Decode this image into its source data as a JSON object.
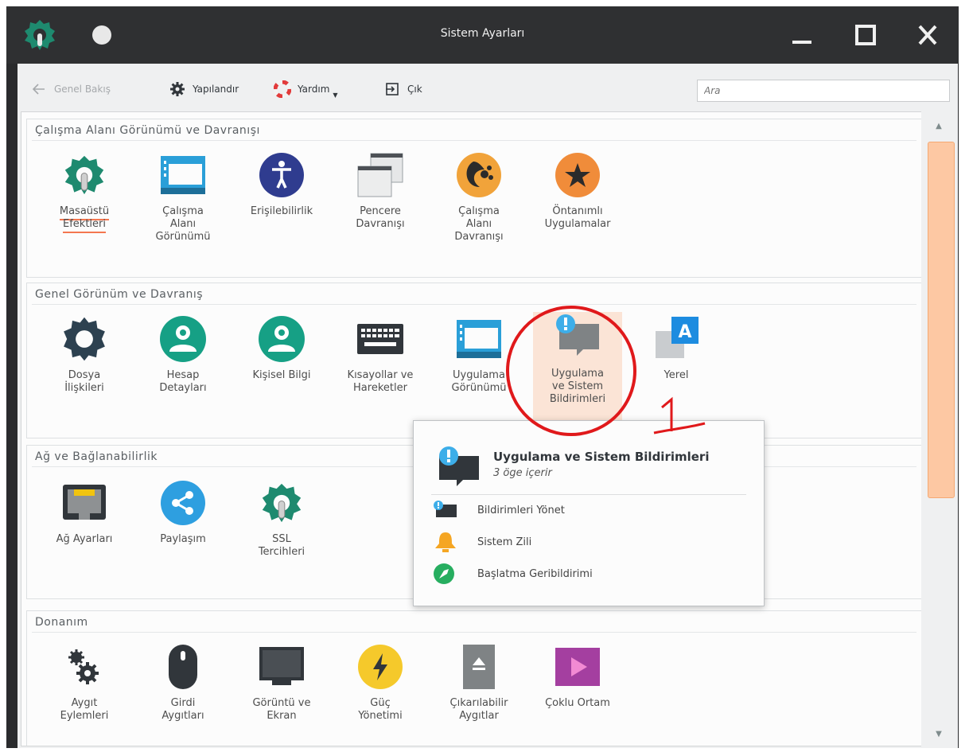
{
  "window": {
    "title": "Sistem Ayarları"
  },
  "toolbar": {
    "back_label": "Genel Bakış",
    "configure_label": "Yapılandır",
    "help_label": "Yardım",
    "quit_label": "Çık",
    "search_placeholder": "Ara"
  },
  "sections": [
    {
      "title": "Çalışma Alanı Görünümü ve Davranışı",
      "items": [
        {
          "label": "Masaüstü\nEfektleri",
          "icon": "desktop-effects-icon"
        },
        {
          "label": "Çalışma\nAlanı\nGörünümü",
          "icon": "workspace-appearance-icon"
        },
        {
          "label": "Erişilebilirlik",
          "icon": "accessibility-icon"
        },
        {
          "label": "Pencere\nDavranışı",
          "icon": "window-behavior-icon"
        },
        {
          "label": "Çalışma\nAlanı\nDavranışı",
          "icon": "workspace-behavior-icon"
        },
        {
          "label": "Öntanımlı\nUygulamalar",
          "icon": "default-apps-icon"
        }
      ]
    },
    {
      "title": "Genel Görünüm ve Davranış",
      "items": [
        {
          "label": "Dosya\nİlişkileri",
          "icon": "file-associations-icon"
        },
        {
          "label": "Hesap\nDetayları",
          "icon": "account-details-icon"
        },
        {
          "label": "Kişisel Bilgi",
          "icon": "personal-info-icon"
        },
        {
          "label": "Kısayollar ve\nHareketler",
          "icon": "shortcuts-icon"
        },
        {
          "label": "Uygulama\nGörünümü",
          "icon": "app-appearance-icon"
        },
        {
          "label": "Uygulama\nve Sistem\nBildirimleri",
          "icon": "notifications-icon"
        },
        {
          "label": "Yerel",
          "icon": "locale-icon"
        }
      ]
    },
    {
      "title": "Ağ ve Bağlanabilirlik",
      "items": [
        {
          "label": "Ağ Ayarları",
          "icon": "network-icon"
        },
        {
          "label": "Paylaşım",
          "icon": "sharing-icon"
        },
        {
          "label": "SSL\nTercihleri",
          "icon": "ssl-icon"
        }
      ]
    },
    {
      "title": "Donanım",
      "items": [
        {
          "label": "Aygıt\nEylemleri",
          "icon": "device-actions-icon"
        },
        {
          "label": "Girdi\nAygıtları",
          "icon": "input-devices-icon"
        },
        {
          "label": "Görüntü ve\nEkran",
          "icon": "display-icon"
        },
        {
          "label": "Güç\nYönetimi",
          "icon": "power-icon"
        },
        {
          "label": "Çıkarılabilir\nAygıtlar",
          "icon": "removable-devices-icon"
        },
        {
          "label": "Çoklu Ortam",
          "icon": "multimedia-icon"
        }
      ]
    }
  ],
  "popup": {
    "title": "Uygulama ve Sistem Bildirimleri",
    "subtitle": "3 öge içerir",
    "items": [
      {
        "label": "Bildirimleri Yönet",
        "icon": "manage-notifications-icon"
      },
      {
        "label": "Sistem Zili",
        "icon": "bell-icon"
      },
      {
        "label": "Başlatma Geribildirimi",
        "icon": "launch-feedback-icon"
      }
    ]
  },
  "annotation": {
    "text": "1",
    "color": "#e0191b"
  },
  "colors": {
    "accent": "#f47750",
    "scroll_thumb": "#fdc8a3",
    "titlebar": "#2f3032",
    "teal": "#16a085",
    "blue": "#3daee9",
    "navy": "#2f3c8f"
  }
}
